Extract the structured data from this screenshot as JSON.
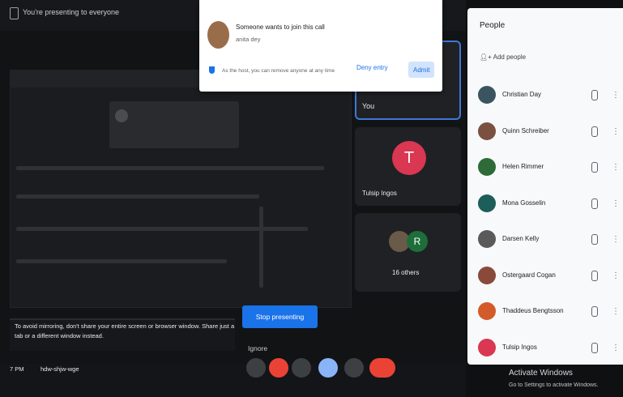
{
  "topbar": {
    "presenting_text": "You're presenting to everyone"
  },
  "shared_window": {},
  "tiles": [
    {
      "label": "You"
    },
    {
      "initial": "T",
      "label": "Tulsip Ingos"
    },
    {
      "initial": "R",
      "label": "16 others"
    }
  ],
  "present_controls": {
    "stop_label": "Stop presenting",
    "ignore_label": "Ignore",
    "warning": "To avoid mirroring, don't share your entire screen or browser window. Share just a tab or a different window instead."
  },
  "bottombar": {
    "time": "7 PM",
    "meeting_code": "hdw-shjw-wge"
  },
  "people": {
    "title": "People",
    "add_label": "Add people",
    "members": [
      {
        "name": "Christian Day",
        "color": "#3a5560"
      },
      {
        "name": "Quinn Schreiber",
        "color": "#7a5140"
      },
      {
        "name": "Helen Rimmer",
        "color": "#2e6b38"
      },
      {
        "name": "Mona Gosselin",
        "color": "#1d5d5a"
      },
      {
        "name": "Darsen Kelly",
        "color": "#5a5a5a"
      },
      {
        "name": "Ostergaard Cogan",
        "color": "#8a4a3a"
      },
      {
        "name": "Thaddeus Bengtsson",
        "color": "#d35b2a"
      },
      {
        "name": "Tulsip Ingos",
        "color": "#d93752"
      }
    ]
  },
  "admit_popup": {
    "title": "Someone wants to join this call",
    "subtitle": "anita dey",
    "note": "As the host, you can remove anyone at any time",
    "deny_label": "Deny entry",
    "admit_label": "Admit"
  },
  "windows_activation": {
    "title": "Activate Windows",
    "subtitle": "Go to Settings to activate Windows."
  },
  "colors": {
    "accent": "#1a73e8",
    "panel_bg": "#f8f9fa",
    "end_call": "#ea4335"
  }
}
